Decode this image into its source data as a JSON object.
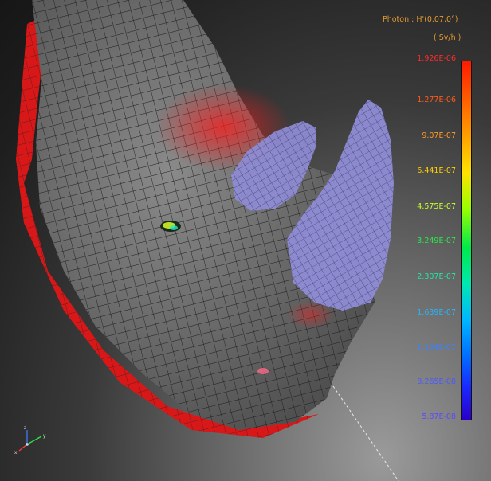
{
  "legend": {
    "title": "Photon : H'(0.07,0°)",
    "unit": "( Sv/h )",
    "ticks": [
      {
        "label": "1.926E-06",
        "color": "#ff2a2a"
      },
      {
        "label": "1.277E-06",
        "color": "#ff5a1a"
      },
      {
        "label": "9.07E-07",
        "color": "#ff9a22"
      },
      {
        "label": "6.441E-07",
        "color": "#ffd000"
      },
      {
        "label": "4.575E-07",
        "color": "#c8ff2a"
      },
      {
        "label": "3.249E-07",
        "color": "#2ae84a"
      },
      {
        "label": "2.307E-07",
        "color": "#22e8a0"
      },
      {
        "label": "1.639E-07",
        "color": "#22b8ff"
      },
      {
        "label": "1.164E-07",
        "color": "#3a82ff"
      },
      {
        "label": "8.265E-08",
        "color": "#4a5aff"
      },
      {
        "label": "5.87E-08",
        "color": "#5a4aff"
      }
    ]
  },
  "axes": {
    "x": "x",
    "y": "y",
    "z": "z"
  },
  "colors": {
    "mesh": "#6b6b6b",
    "mesh_lines": "#1c1c1c",
    "horn": "#8f8cd6",
    "hot_spot": "#e21616",
    "background": "#2a2a2a"
  }
}
